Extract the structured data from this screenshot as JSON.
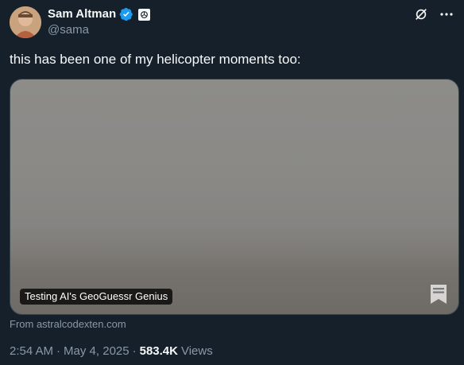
{
  "author": {
    "display_name": "Sam Altman",
    "handle": "@sama",
    "verified": true,
    "affiliate_badge_icon": "openai-logo-icon",
    "avatar_icon": "profile-avatar"
  },
  "header_actions": {
    "grok_icon": "grok-icon",
    "more_icon": "more-options-icon"
  },
  "tweet": {
    "text": "this has been one of my helicopter moments too:"
  },
  "card": {
    "title": "Testing AI's GeoGuessr Genius",
    "source": "From astralcodexten.com",
    "bookmark_icon": "bookmark-icon"
  },
  "meta": {
    "time": "2:54 AM",
    "separator": "·",
    "date": "May 4, 2025",
    "views_count": "583.4K",
    "views_label": "Views"
  },
  "colors": {
    "background": "#15202b",
    "text_primary": "#f7f9f9",
    "text_secondary": "#8b98a5",
    "verified_blue": "#1d9bf0",
    "border": "#38444d"
  }
}
